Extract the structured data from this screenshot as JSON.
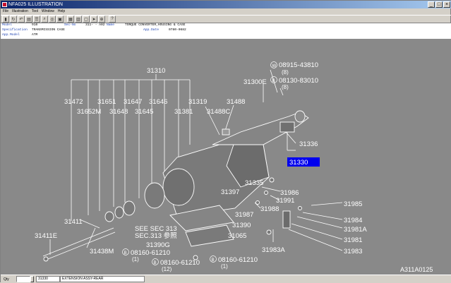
{
  "window": {
    "title": "NFA025  ILLUSTRATION"
  },
  "menu": [
    "File",
    "Illustration",
    "Tool",
    "Window",
    "Help"
  ],
  "info": {
    "model_label": "Model",
    "model_value": "910",
    "secno_label": "Sec-No",
    "secno_value": "311-  - A02",
    "name_label": "Name",
    "name_value": "TORQUE CONVERTER,HOUSING & CASE",
    "spec_label": "Specification",
    "spec_value": "TRANSMISSION CASE",
    "appdate_label": "App.Date",
    "appdate_value": "0780-0682",
    "appmodel_label": "App.Model",
    "appmodel_value": "ATM"
  },
  "diagram": {
    "labels": {
      "l31310": "31310",
      "l31472": "31472",
      "l31651": "31651",
      "l31647": "31647",
      "l31646": "31646",
      "l31319": "31319",
      "l31488": "31488",
      "l31652m": "31652M",
      "l31648": "31648",
      "l31645": "31645",
      "l31381": "31381",
      "l31488c": "31488C",
      "l31300e": "31300E",
      "c08915_a": "W",
      "l08915": "08915-43810",
      "q08915": "(8)",
      "c08130_a": "B",
      "l08130": "08130-83010",
      "q08130": "(8)",
      "l31336": "31336",
      "l31330": "31330",
      "l31335": "31335",
      "l31397": "31397",
      "l31986": "31986",
      "l31991": "31991",
      "l31988": "31988",
      "l31987": "31987",
      "l31985": "31985",
      "l31984": "31984",
      "l31981a": "31981A",
      "l31981": "31981",
      "l31983": "31983",
      "l31983a": "31983A",
      "l31411": "31411",
      "l31411e": "31411E",
      "l31438m": "31438M",
      "seesec1": "SEE SEC 313",
      "seesec2": "SEC.313 参照",
      "l31390": "31390",
      "l31065": "31065",
      "l31390g": "31390G",
      "c08160a": "B",
      "l08160a": "08160-61210",
      "q08160a": "(1)",
      "c08160b": "B",
      "l08160b": "08160-61210",
      "q08160b": "(12)",
      "c08160c": "B",
      "l08160c": "08160-61210",
      "q08160c": "(1)",
      "figno": "A311A0125"
    }
  },
  "status": {
    "qty_label": "Qty",
    "part_value": "31330",
    "desc_value": "EXTENSION ASSY-REAR"
  }
}
